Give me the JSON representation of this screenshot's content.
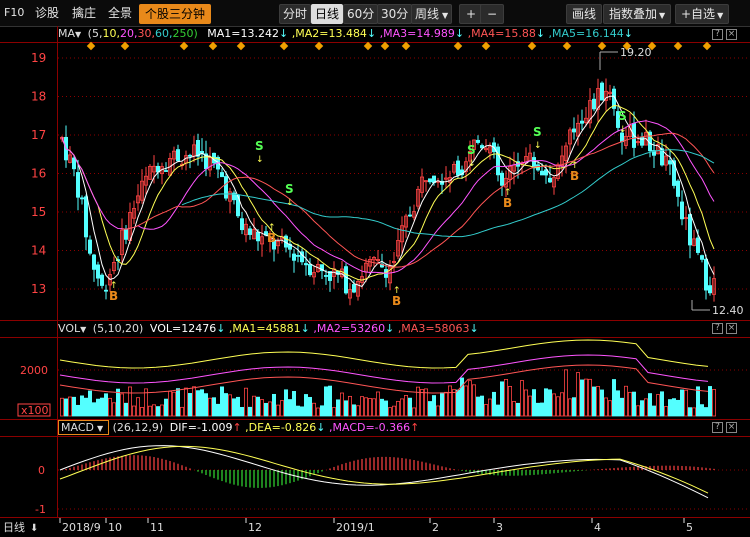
{
  "toolbar": {
    "f10": "F10",
    "diagnose": "诊股",
    "bottom_fish": "擒庄",
    "panorama": "全景",
    "three_min": "个股三分钟",
    "period_minute": "分时",
    "period_day": "日线",
    "period_60": "60分",
    "period_30": "30分",
    "period_week": "周线",
    "zoom_in": "+",
    "zoom_out": "−",
    "draw_line": "画线",
    "index_overlay": "指数叠加",
    "add_watch": "+自选"
  },
  "ma_bar": {
    "name": "MA",
    "params_prefix": "(5,",
    "p10": "10,",
    "p20": "20,",
    "p30": "30,",
    "p60": "60,",
    "p250": "250)",
    "ma1": "MA1=13.242",
    "ma2": ",MA2=13.484",
    "ma3": ",MA3=14.989",
    "ma4": ",MA4=15.88",
    "ma5": ",MA5=16.144"
  },
  "vol_bar": {
    "name": "VOL",
    "params": "(5,10,20)",
    "vol": "VOL=12476",
    "ma1": ",MA1=45881",
    "ma2": ",MA2=53260",
    "ma3": ",MA3=58063"
  },
  "macd_bar": {
    "name": "MACD",
    "params": "(26,12,9)",
    "dif": "DIF=-1.009",
    "dea": ",DEA=-0.826",
    "macd": ",MACD=-0.366"
  },
  "price_axis": [
    "19",
    "18",
    "17",
    "16",
    "15",
    "14",
    "13"
  ],
  "vol_axis": {
    "top": "2000",
    "unit": "x100"
  },
  "macd_axis": [
    "0",
    "-1"
  ],
  "annotations": {
    "high": "19.20",
    "low": "12.40"
  },
  "signal_labels": {
    "buy": "B",
    "sell": "S"
  },
  "date_axis": {
    "period": "日线",
    "labels": [
      "2018/9",
      "10",
      "11",
      "12",
      "2019/1",
      "2",
      "3",
      "4",
      "5"
    ]
  },
  "colors": {
    "up": "#ff4444",
    "down": "#54ffff",
    "ma5": "#ffffff",
    "ma10": "#ffff55",
    "ma20": "#ff55ff",
    "ma30": "#ff5555",
    "ma60": "#33cccc",
    "grid": "#8b0000",
    "accent": "#e8891a"
  }
}
